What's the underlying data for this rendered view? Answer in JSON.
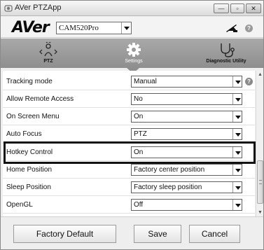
{
  "window": {
    "title": "AVer PTZApp",
    "controls": {
      "minimize": "—",
      "maximize": "▫",
      "close": "✕"
    }
  },
  "header": {
    "logo": "AVer",
    "camera_select": "CAM520Pro",
    "help_icon": "?"
  },
  "tabs": [
    {
      "label": "PTZ",
      "icon": "ptz-icon",
      "selected": false
    },
    {
      "label": "Settings",
      "icon": "gear-icon",
      "selected": true
    },
    {
      "label": "Diagnostic Utility",
      "icon": "stethoscope-icon",
      "selected": false
    }
  ],
  "settings": [
    {
      "label": "Tracking mode",
      "value": "Manual",
      "has_help": true
    },
    {
      "label": "Allow Remote Access",
      "value": "No"
    },
    {
      "label": "On Screen Menu",
      "value": "On"
    },
    {
      "label": "Auto Focus",
      "value": "PTZ"
    },
    {
      "label": "Hotkey Control",
      "value": "On",
      "highlighted": true
    },
    {
      "label": "Home Position",
      "value": "Factory center position"
    },
    {
      "label": "Sleep Position",
      "value": "Factory sleep position"
    },
    {
      "label": "OpenGL",
      "value": "Off"
    }
  ],
  "row_help": "?",
  "footer": {
    "factory_default": "Factory Default",
    "save": "Save",
    "cancel": "Cancel"
  },
  "colors": {
    "tabbar": "#9a9a9a",
    "highlight_border": "#111111"
  }
}
